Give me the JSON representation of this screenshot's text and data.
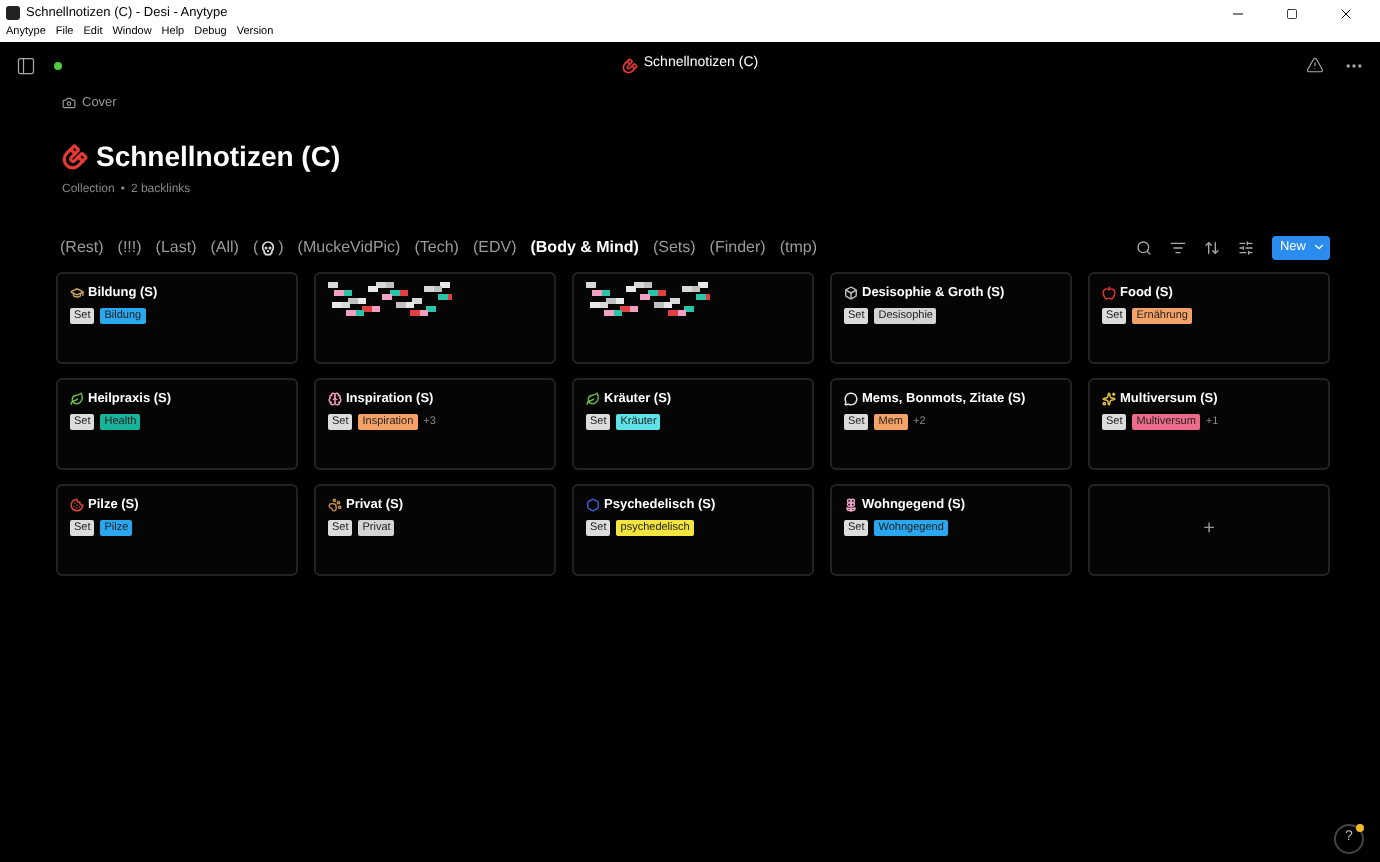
{
  "window": {
    "title": "Schnellnotizen (C) - Desi - Anytype"
  },
  "menu": [
    "Anytype",
    "File",
    "Edit",
    "Window",
    "Help",
    "Debug",
    "Version"
  ],
  "header": {
    "title": "Schnellnotizen (C)"
  },
  "cover_button": "Cover",
  "page": {
    "title": "Schnellnotizen (C)",
    "type": "Collection",
    "separator": "•",
    "backlinks": "2 backlinks"
  },
  "tabs": [
    {
      "kind": "text",
      "label": "(Rest)",
      "selected": false
    },
    {
      "kind": "text",
      "label": "(!!!)",
      "selected": false
    },
    {
      "kind": "text",
      "label": "(Last)",
      "selected": false
    },
    {
      "kind": "text",
      "label": "(All)",
      "selected": false
    },
    {
      "kind": "icon",
      "open": "(",
      "close": ")",
      "selected": false
    },
    {
      "kind": "text",
      "label": "(MuckeVidPic)",
      "selected": false
    },
    {
      "kind": "text",
      "label": "(Tech)",
      "selected": false
    },
    {
      "kind": "text",
      "label": "(EDV)",
      "selected": false
    },
    {
      "kind": "text",
      "label": "(Body & Mind)",
      "selected": true
    },
    {
      "kind": "text",
      "label": "(Sets)",
      "selected": false
    },
    {
      "kind": "text",
      "label": "(Finder)",
      "selected": false
    },
    {
      "kind": "text",
      "label": "(tmp)",
      "selected": false
    }
  ],
  "new_button": "New",
  "cards": [
    {
      "kind": "card",
      "title": "Bildung (S)",
      "type": "Set",
      "tags": [
        {
          "label": "Bildung",
          "color": "#2aa7ee"
        }
      ]
    },
    {
      "kind": "obscured"
    },
    {
      "kind": "obscured"
    },
    {
      "kind": "card",
      "title": "Desisophie & Groth (S)",
      "type": "Set",
      "tags": [
        {
          "label": "Desisophie",
          "color": "#d4d4d4"
        }
      ]
    },
    {
      "kind": "card",
      "title": "Food (S)",
      "type": "Set",
      "tags": [
        {
          "label": "Ernährung",
          "color": "#f5a266"
        }
      ]
    },
    {
      "kind": "card",
      "title": "Heilpraxis (S)",
      "type": "Set",
      "tags": [
        {
          "label": "Health",
          "color": "#19b39b"
        }
      ]
    },
    {
      "kind": "card",
      "title": "Inspiration (S)",
      "type": "Set",
      "tags": [
        {
          "label": "Inspiration",
          "color": "#f5a266"
        }
      ],
      "more": "+3"
    },
    {
      "kind": "card",
      "title": "Kräuter (S)",
      "type": "Set",
      "tags": [
        {
          "label": "Kräuter",
          "color": "#5de2e8"
        }
      ]
    },
    {
      "kind": "card",
      "title": "Mems, Bonmots, Zitate (S)",
      "type": "Set",
      "tags": [
        {
          "label": "Mem",
          "color": "#f5a266"
        }
      ],
      "more": "+2"
    },
    {
      "kind": "card",
      "title": "Multiversum (S)",
      "type": "Set",
      "tags": [
        {
          "label": "Multiversum",
          "color": "#ee6b8c"
        }
      ],
      "more": "+1"
    },
    {
      "kind": "card",
      "title": "Pilze (S)",
      "type": "Set",
      "tags": [
        {
          "label": "Pilze",
          "color": "#2aa7ee"
        }
      ]
    },
    {
      "kind": "card",
      "title": "Privat (S)",
      "type": "Set",
      "tags": [
        {
          "label": "Privat",
          "color": "#d4d4d4"
        }
      ]
    },
    {
      "kind": "card",
      "title": "Psychedelisch (S)",
      "type": "Set",
      "tags": [
        {
          "label": "psychedelisch",
          "color": "#f3e53f"
        }
      ]
    },
    {
      "kind": "card",
      "title": "Wohngegend (S)",
      "type": "Set",
      "tags": [
        {
          "label": "Wohngegend",
          "color": "#2aa7ee"
        }
      ]
    },
    {
      "kind": "add",
      "label": "+"
    }
  ],
  "help_button": "?"
}
